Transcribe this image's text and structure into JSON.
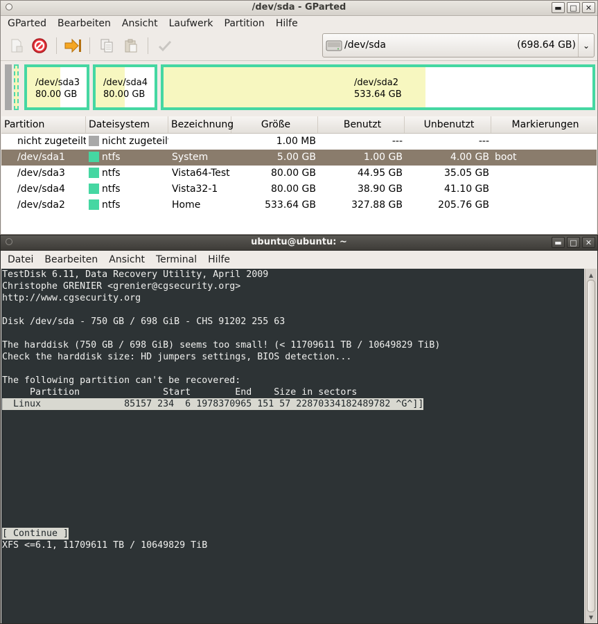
{
  "gparted": {
    "title": "/dev/sda - GParted",
    "menu": [
      "GParted",
      "Bearbeiten",
      "Ansicht",
      "Laufwerk",
      "Partition",
      "Hilfe"
    ],
    "device": {
      "label": "/dev/sda",
      "size": "(698.64 GB)"
    },
    "map": [
      {
        "name": "/dev/sda3",
        "size": "80.00 GB",
        "used_fraction": 0.56
      },
      {
        "name": "/dev/sda4",
        "size": "80.00 GB",
        "used_fraction": 0.49
      },
      {
        "name": "/dev/sda2",
        "size": "533.64 GB",
        "used_fraction": 0.61
      }
    ],
    "columns": [
      "Partition",
      "Dateisystem",
      "Bezeichnung",
      "Größe",
      "Benutzt",
      "Unbenutzt",
      "Markierungen"
    ],
    "rows": [
      {
        "partition": "nicht zugeteilt",
        "fs": "nicht zugeteilt",
        "fs_color": "#a8a8a8",
        "label": "",
        "size": "1.00 MB",
        "used": "---",
        "unused": "---",
        "flags": ""
      },
      {
        "partition": "/dev/sda1",
        "fs": "ntfs",
        "fs_color": "#45d7a2",
        "label": "System",
        "size": "5.00 GB",
        "used": "1.00 GB",
        "unused": "4.00 GB",
        "flags": "boot"
      },
      {
        "partition": "/dev/sda3",
        "fs": "ntfs",
        "fs_color": "#45d7a2",
        "label": "Vista64-Test",
        "size": "80.00 GB",
        "used": "44.95 GB",
        "unused": "35.05 GB",
        "flags": ""
      },
      {
        "partition": "/dev/sda4",
        "fs": "ntfs",
        "fs_color": "#45d7a2",
        "label": "Vista32-1",
        "size": "80.00 GB",
        "used": "38.90 GB",
        "unused": "41.10 GB",
        "flags": ""
      },
      {
        "partition": "/dev/sda2",
        "fs": "ntfs",
        "fs_color": "#45d7a2",
        "label": "Home",
        "size": "533.64 GB",
        "used": "327.88 GB",
        "unused": "205.76 GB",
        "flags": ""
      }
    ],
    "selected_row": 1,
    "toolbar_icons": [
      "new-partition-icon",
      "delete-icon",
      "resize-move-icon",
      "copy-icon",
      "paste-icon",
      "apply-icon"
    ]
  },
  "terminal": {
    "title": "ubuntu@ubuntu: ~",
    "menu": [
      "Datei",
      "Bearbeiten",
      "Ansicht",
      "Terminal",
      "Hilfe"
    ],
    "lines": [
      "TestDisk 6.11, Data Recovery Utility, April 2009",
      "Christophe GRENIER <grenier@cgsecurity.org>",
      "http://www.cgsecurity.org",
      "",
      "Disk /dev/sda - 750 GB / 698 GiB - CHS 91202 255 63",
      "",
      "The harddisk (750 GB / 698 GiB) seems too small! (< 11709611 TB / 10649829 TiB)",
      "Check the harddisk size: HD jumpers settings, BIOS detection...",
      "",
      "The following partition can't be recovered:",
      "     Partition               Start        End    Size in sectors"
    ],
    "highlight_line": "  Linux               85157 234  6 1978370965 151 57 22870334182489782 ^G^]]",
    "continue_button": "[ Continue ]",
    "status_line": "XFS <=6.1, 11709611 TB / 10649829 TiB"
  }
}
